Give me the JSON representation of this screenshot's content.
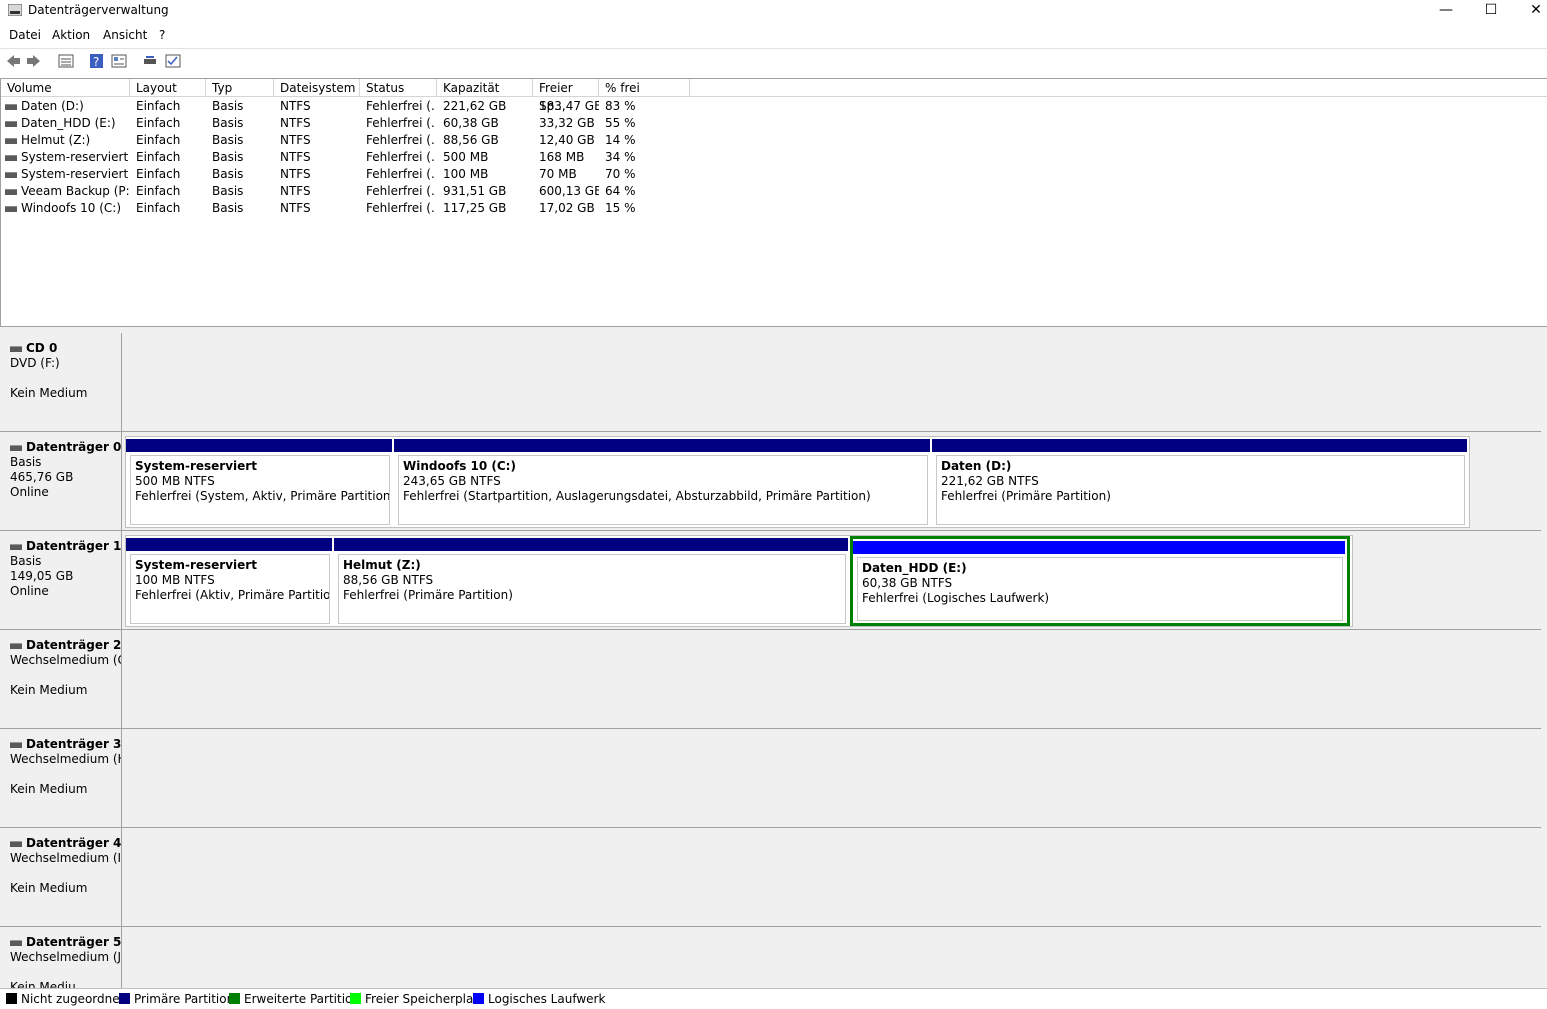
{
  "window": {
    "title": "Datenträgerverwaltung",
    "minimize": "—",
    "maximize": "☐",
    "close": "✕"
  },
  "menu": [
    "Datei",
    "Aktion",
    "Ansicht",
    "?"
  ],
  "toolbar": [
    "back-icon",
    "forward-icon",
    "list-view-icon",
    "help-icon",
    "properties-icon",
    "connect-icon",
    "check-icon"
  ],
  "columns": [
    "Volume",
    "Layout",
    "Typ",
    "Dateisystem",
    "Status",
    "Kapazität",
    "Freier Sp...",
    "% frei"
  ],
  "volumes": [
    [
      "Daten (D:)",
      "Einfach",
      "Basis",
      "NTFS",
      "Fehlerfrei (...",
      "221,62 GB",
      "183,47 GB",
      "83 %"
    ],
    [
      "Daten_HDD (E:)",
      "Einfach",
      "Basis",
      "NTFS",
      "Fehlerfrei (...",
      "60,38 GB",
      "33,32 GB",
      "55 %"
    ],
    [
      "Helmut (Z:)",
      "Einfach",
      "Basis",
      "NTFS",
      "Fehlerfrei (...",
      "88,56 GB",
      "12,40 GB",
      "14 %"
    ],
    [
      "System-reserviert",
      "Einfach",
      "Basis",
      "NTFS",
      "Fehlerfrei (...",
      "500 MB",
      "168 MB",
      "34 %"
    ],
    [
      "System-reserviert",
      "Einfach",
      "Basis",
      "NTFS",
      "Fehlerfrei (...",
      "100 MB",
      "70 MB",
      "70 %"
    ],
    [
      "Veeam Backup (P:)",
      "Einfach",
      "Basis",
      "NTFS",
      "Fehlerfrei (...",
      "931,51 GB",
      "600,13 GB",
      "64 %"
    ],
    [
      "Windoofs 10 (C:)",
      "Einfach",
      "Basis",
      "NTFS",
      "Fehlerfrei (...",
      "117,25 GB",
      "17,02 GB",
      "15 %"
    ]
  ],
  "disks": [
    {
      "name": "CD 0",
      "lines": [
        "DVD (F:)",
        "",
        "Kein Medium"
      ],
      "icon": "cd-drive-icon"
    },
    {
      "name": "Datenträger 0",
      "lines": [
        "Basis",
        "465,76 GB",
        "Online"
      ],
      "icon": "disk-icon",
      "partitions": [
        {
          "name": "System-reserviert",
          "size": "500 MB NTFS",
          "status": "Fehlerfrei (System, Aktiv, Primäre Partition)",
          "kind": "primary"
        },
        {
          "name": "Windoofs 10  (C:)",
          "size": "243,65 GB NTFS",
          "status": "Fehlerfrei (Startpartition, Auslagerungsdatei, Absturzabbild, Primäre Partition)",
          "kind": "primary"
        },
        {
          "name": "Daten  (D:)",
          "size": "221,62 GB NTFS",
          "status": "Fehlerfrei (Primäre Partition)",
          "kind": "primary"
        }
      ]
    },
    {
      "name": "Datenträger 1",
      "lines": [
        "Basis",
        "149,05 GB",
        "Online"
      ],
      "icon": "disk-icon",
      "partitions": [
        {
          "name": "System-reserviert",
          "size": "100 MB NTFS",
          "status": "Fehlerfrei (Aktiv, Primäre Partition)",
          "kind": "primary"
        },
        {
          "name": "Helmut  (Z:)",
          "size": "88,56 GB NTFS",
          "status": "Fehlerfrei (Primäre Partition)",
          "kind": "primary"
        },
        {
          "name": "Daten_HDD  (E:)",
          "size": "60,38 GB NTFS",
          "status": "Fehlerfrei (Logisches Laufwerk)",
          "kind": "logical",
          "selected": true
        }
      ]
    },
    {
      "name": "Datenträger 2",
      "lines": [
        "Wechselmedium (G:",
        "",
        "Kein Medium"
      ],
      "icon": "disk-icon"
    },
    {
      "name": "Datenträger 3",
      "lines": [
        "Wechselmedium (H",
        "",
        "Kein Medium"
      ],
      "icon": "disk-icon"
    },
    {
      "name": "Datenträger 4",
      "lines": [
        "Wechselmedium (I:)",
        "",
        "Kein Medium"
      ],
      "icon": "disk-icon"
    },
    {
      "name": "Datenträger 5",
      "lines": [
        "Wechselmedium (J:)",
        "",
        "Kein Mediu"
      ],
      "icon": "disk-icon"
    }
  ],
  "legend": [
    {
      "label": "Nicht zugeordnet",
      "color": "#000000"
    },
    {
      "label": "Primäre Partition",
      "color": "#000080"
    },
    {
      "label": "Erweiterte Partition",
      "color": "#008000"
    },
    {
      "label": "Freier Speicherplatz",
      "color": "#00ff00"
    },
    {
      "label": "Logisches Laufwerk",
      "color": "#0000ff"
    }
  ]
}
